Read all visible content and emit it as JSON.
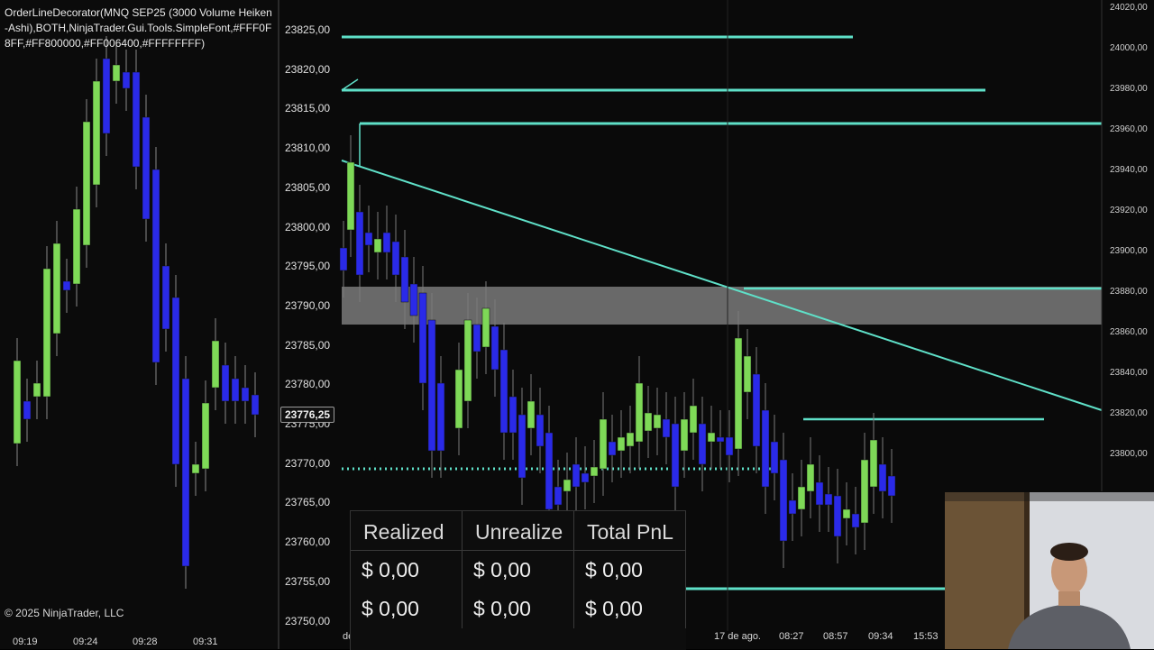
{
  "indicator": {
    "label": "OrderLineDecorator(MNQ SEP25 (3000 Volume Heiken-Ashi),BOTH,NinjaTrader.Gui.Tools.SimpleFont,#FFF0F8FF,#FF800000,#FF006400,#FFFFFFFF)"
  },
  "copyright": "© 2025 NinjaTrader, LLC",
  "left_time_labels": [
    "09:19",
    "09:24",
    "09:28",
    "09:31"
  ],
  "price_axis": [
    "23825,00",
    "23820,00",
    "23815,00",
    "23810,00",
    "23805,00",
    "23800,00",
    "23795,00",
    "23790,00",
    "23785,00",
    "23780,00",
    "23775,00",
    "23770,00",
    "23765,00",
    "23760,00",
    "23755,00",
    "23750,00"
  ],
  "current_price": "23776,25",
  "right_price_axis": [
    "24020,00",
    "24000,00",
    "23980,00",
    "23960,00",
    "23940,00",
    "23920,00",
    "23900,00",
    "23880,00",
    "23860,00",
    "23840,00",
    "23820,00",
    "23800,00"
  ],
  "right_time_labels": [
    "de",
    "17 de ago.",
    "08:27",
    "08:57",
    "09:34",
    "15:53"
  ],
  "pnl": {
    "headers": [
      "Realized",
      "Unrealize",
      "Total PnL"
    ],
    "rows": [
      [
        "$ 0,00",
        "$ 0,00",
        "$ 0,00"
      ],
      [
        "$ 0,00",
        "$ 0,00",
        "$ 0,00"
      ]
    ]
  },
  "colors": {
    "bull": "#7ed957",
    "bear": "#2a2ae8",
    "line": "#5fe0c8",
    "zone": "#8a8a8a"
  }
}
